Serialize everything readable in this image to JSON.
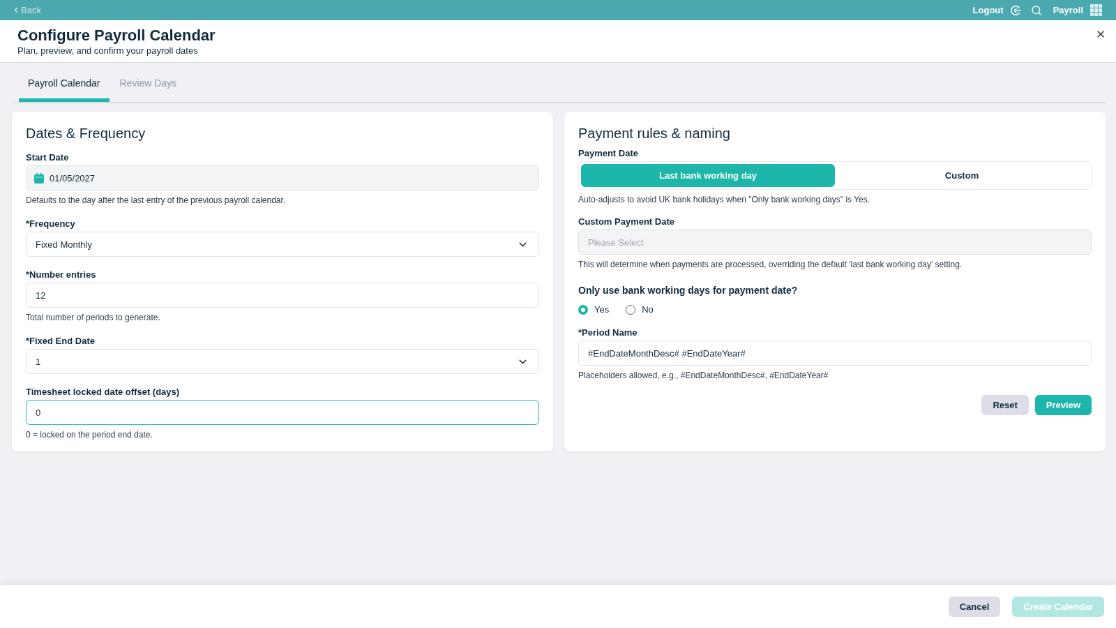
{
  "top_bar": {
    "back": "Back",
    "logout": "Logout",
    "app_name": "Payroll"
  },
  "header": {
    "title": "Configure Payroll Calendar",
    "subtitle": "Plan, preview, and confirm your payroll dates"
  },
  "tabs": [
    {
      "label": "Payroll Calendar",
      "selected": true
    },
    {
      "label": "Review Days",
      "selected": false
    }
  ],
  "dates_panel": {
    "title": "Dates & Frequency",
    "fields": [
      {
        "kind": "date",
        "label": "Start Date",
        "value": "01/05/2027",
        "help": "Defaults to the day after the last entry of the previous payroll calendar.",
        "disabled": true,
        "focused": false
      },
      {
        "kind": "select",
        "label": "*Frequency",
        "value": "Fixed Monthly",
        "disabled": false,
        "focused": false
      },
      {
        "kind": "text",
        "label": "*Number entries",
        "value": "12",
        "help": "Total number of periods to generate.",
        "disabled": false,
        "focused": false
      },
      {
        "kind": "select",
        "label": "*Fixed End Date",
        "value": "1",
        "disabled": false,
        "focused": false
      },
      {
        "kind": "text",
        "label": "Timesheet locked date offset (days)",
        "value": "0",
        "help": "0 = locked on the period end date.",
        "disabled": false,
        "focused": true
      }
    ]
  },
  "payment_panel": {
    "title": "Payment rules & naming",
    "payment_date": {
      "label": "Payment Date",
      "options": [
        {
          "label": "Last bank working day",
          "selected": true
        },
        {
          "label": "Custom",
          "selected": false
        }
      ],
      "help": "Auto-adjusts to avoid UK bank holidays when \"Only bank working days\" is Yes."
    },
    "custom_payment_date": {
      "label": "Custom Payment Date",
      "placeholder": "Please Select",
      "disabled": true,
      "help": "This will determine when payments are processed, overriding the default 'last bank working day' setting."
    },
    "bank_days": {
      "question": "Only use bank working days for payment date?",
      "options": [
        {
          "label": "Yes",
          "selected": true
        },
        {
          "label": "No",
          "selected": false
        }
      ]
    },
    "period_name": {
      "label": "*Period Name",
      "value": "#EndDateMonthDesc# #EndDateYear#",
      "help": "Placeholders allowed, e.g., #EndDateMonthDesc#, #EndDateYear#"
    },
    "buttons": [
      {
        "label": "Reset",
        "kind": "secondary",
        "disabled": false
      },
      {
        "label": "Preview",
        "kind": "primary",
        "disabled": false
      }
    ]
  },
  "footer": {
    "buttons": [
      {
        "label": "Cancel",
        "kind": "secondary",
        "disabled": false
      },
      {
        "label": "Create Calendar",
        "kind": "primary",
        "disabled": true
      }
    ]
  }
}
